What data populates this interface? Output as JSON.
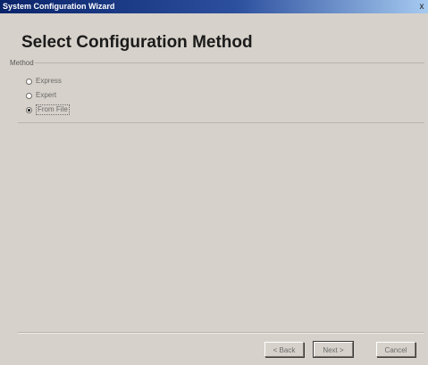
{
  "window": {
    "title": "System Configuration Wizard",
    "close_label": "x"
  },
  "page": {
    "title": "Select Configuration Method"
  },
  "method_group": {
    "label": "Method",
    "options": [
      {
        "label": "Express",
        "checked": false
      },
      {
        "label": "Expert",
        "checked": false
      },
      {
        "label": "From File",
        "checked": true
      }
    ]
  },
  "buttons": {
    "back_label": "< Back",
    "next_label": "Next >",
    "cancel_label": "Cancel"
  }
}
